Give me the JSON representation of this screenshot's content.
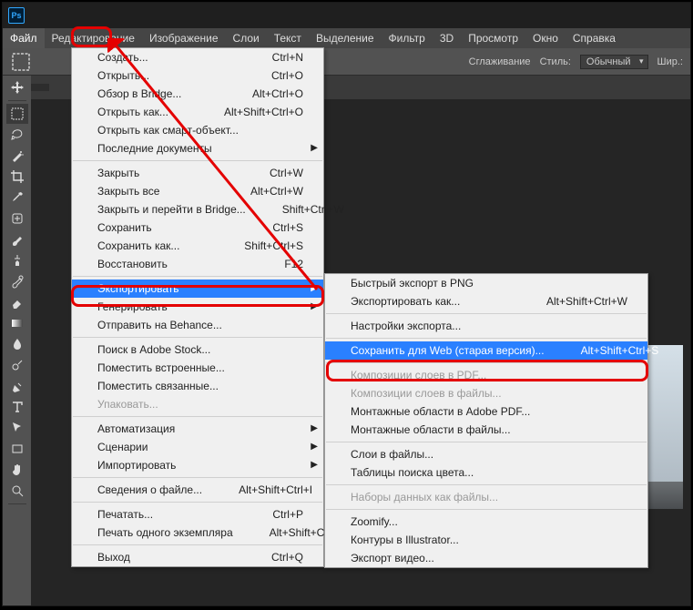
{
  "menubar": {
    "items": [
      "Файл",
      "Редактирование",
      "Изображение",
      "Слои",
      "Текст",
      "Выделение",
      "Фильтр",
      "3D",
      "Просмотр",
      "Окно",
      "Справка"
    ]
  },
  "optbar": {
    "smoothing": "Сглаживание",
    "style_label": "Стиль:",
    "style_value": "Обычный",
    "width_label": "Шир.:"
  },
  "file_menu": [
    {
      "t": "item",
      "label": "Создать...",
      "sc": "Ctrl+N"
    },
    {
      "t": "item",
      "label": "Открыть...",
      "sc": "Ctrl+O"
    },
    {
      "t": "item",
      "label": "Обзор в Bridge...",
      "sc": "Alt+Ctrl+O"
    },
    {
      "t": "item",
      "label": "Открыть как...",
      "sc": "Alt+Shift+Ctrl+O"
    },
    {
      "t": "item",
      "label": "Открыть как смарт-объект..."
    },
    {
      "t": "item",
      "label": "Последние документы",
      "sub": true
    },
    {
      "t": "sep"
    },
    {
      "t": "item",
      "label": "Закрыть",
      "sc": "Ctrl+W"
    },
    {
      "t": "item",
      "label": "Закрыть все",
      "sc": "Alt+Ctrl+W"
    },
    {
      "t": "item",
      "label": "Закрыть и перейти в Bridge...",
      "sc": "Shift+Ctrl+W"
    },
    {
      "t": "item",
      "label": "Сохранить",
      "sc": "Ctrl+S"
    },
    {
      "t": "item",
      "label": "Сохранить как...",
      "sc": "Shift+Ctrl+S"
    },
    {
      "t": "item",
      "label": "Восстановить",
      "sc": "F12"
    },
    {
      "t": "sep"
    },
    {
      "t": "item",
      "label": "Экспортировать",
      "sub": true,
      "hl": true
    },
    {
      "t": "item",
      "label": "Генерировать",
      "sub": true
    },
    {
      "t": "item",
      "label": "Отправить на Behance..."
    },
    {
      "t": "sep"
    },
    {
      "t": "item",
      "label": "Поиск в Adobe Stock..."
    },
    {
      "t": "item",
      "label": "Поместить встроенные..."
    },
    {
      "t": "item",
      "label": "Поместить связанные..."
    },
    {
      "t": "item",
      "label": "Упаковать...",
      "dis": true
    },
    {
      "t": "sep"
    },
    {
      "t": "item",
      "label": "Автоматизация",
      "sub": true
    },
    {
      "t": "item",
      "label": "Сценарии",
      "sub": true
    },
    {
      "t": "item",
      "label": "Импортировать",
      "sub": true
    },
    {
      "t": "sep"
    },
    {
      "t": "item",
      "label": "Сведения о файле...",
      "sc": "Alt+Shift+Ctrl+I"
    },
    {
      "t": "sep"
    },
    {
      "t": "item",
      "label": "Печатать...",
      "sc": "Ctrl+P"
    },
    {
      "t": "item",
      "label": "Печать одного экземпляра",
      "sc": "Alt+Shift+Ctrl+P"
    },
    {
      "t": "sep"
    },
    {
      "t": "item",
      "label": "Выход",
      "sc": "Ctrl+Q"
    }
  ],
  "export_menu": [
    {
      "t": "item",
      "label": "Быстрый экспорт в PNG"
    },
    {
      "t": "item",
      "label": "Экспортировать как...",
      "sc": "Alt+Shift+Ctrl+W"
    },
    {
      "t": "sep"
    },
    {
      "t": "item",
      "label": "Настройки экспорта..."
    },
    {
      "t": "sep"
    },
    {
      "t": "item",
      "label": "Сохранить для Web (старая версия)...",
      "sc": "Alt+Shift+Ctrl+S",
      "hl": true
    },
    {
      "t": "sep"
    },
    {
      "t": "item",
      "label": "Композиции слоев в PDF...",
      "dis": true
    },
    {
      "t": "item",
      "label": "Композиции слоев в файлы...",
      "dis": true
    },
    {
      "t": "item",
      "label": "Монтажные области в Adobe PDF..."
    },
    {
      "t": "item",
      "label": "Монтажные области в файлы..."
    },
    {
      "t": "sep"
    },
    {
      "t": "item",
      "label": "Слои в файлы..."
    },
    {
      "t": "item",
      "label": "Таблицы поиска цвета..."
    },
    {
      "t": "sep"
    },
    {
      "t": "item",
      "label": "Наборы данных как файлы...",
      "dis": true
    },
    {
      "t": "sep"
    },
    {
      "t": "item",
      "label": "Zoomify..."
    },
    {
      "t": "item",
      "label": "Контуры в Illustrator..."
    },
    {
      "t": "item",
      "label": "Экспорт видео..."
    }
  ],
  "tools": [
    "move",
    "marquee",
    "lasso",
    "magic-wand",
    "crop",
    "eyedropper",
    "heal",
    "brush",
    "clone",
    "history-brush",
    "eraser",
    "gradient",
    "blur",
    "dodge",
    "pen",
    "type",
    "path-select",
    "rectangle",
    "hand",
    "zoom"
  ],
  "logo_text": "Ps"
}
